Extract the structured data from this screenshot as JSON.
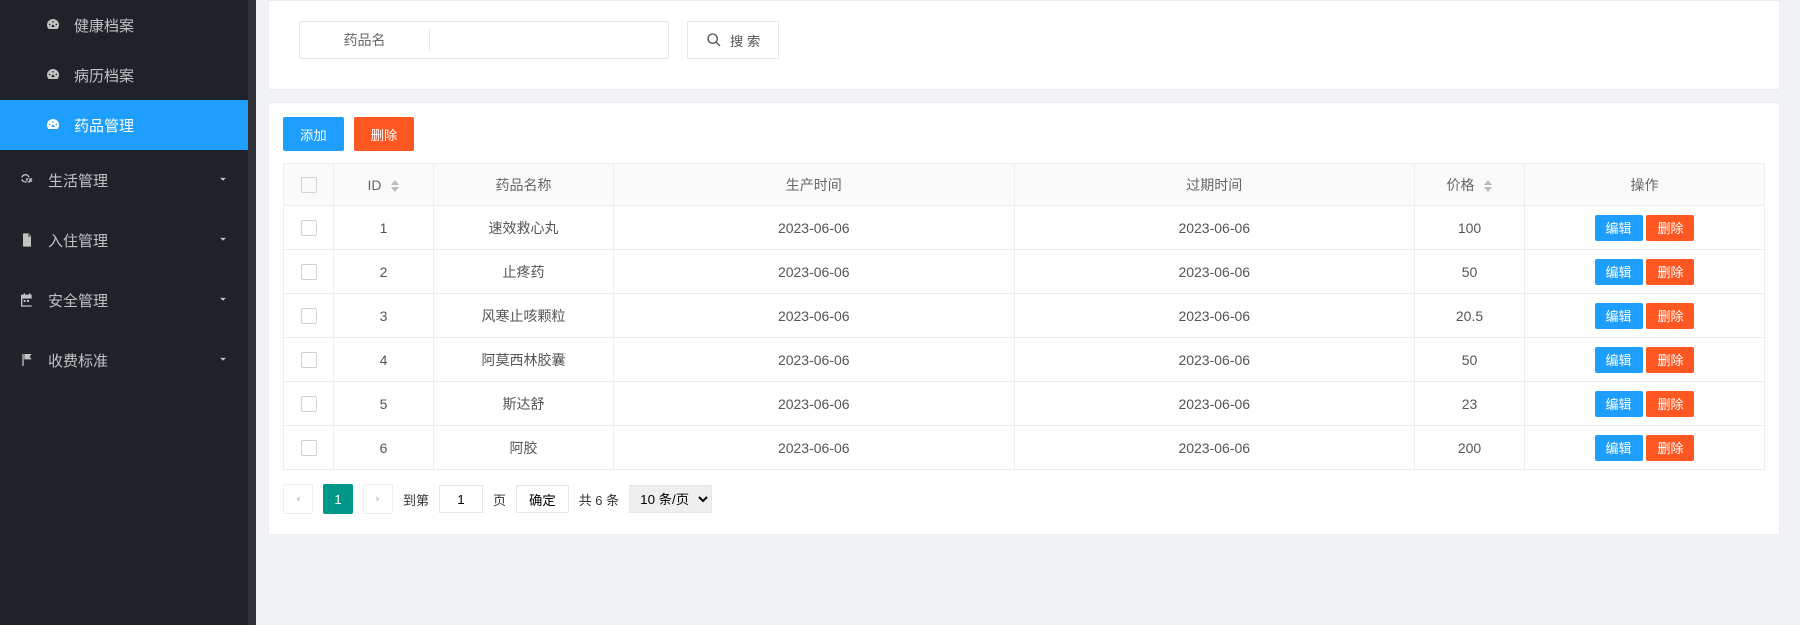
{
  "sidebar": {
    "items": [
      {
        "label": "健康档案",
        "kind": "sub"
      },
      {
        "label": "病历档案",
        "kind": "sub"
      },
      {
        "label": "药品管理",
        "kind": "sub",
        "active": true
      },
      {
        "label": "生活管理",
        "kind": "group"
      },
      {
        "label": "入住管理",
        "kind": "group"
      },
      {
        "label": "安全管理",
        "kind": "group"
      },
      {
        "label": "收费标准",
        "kind": "group"
      }
    ]
  },
  "search": {
    "label": "药品名",
    "value": "",
    "button": "搜 索"
  },
  "toolbar": {
    "add": "添加",
    "del": "删除"
  },
  "table": {
    "headers": {
      "id": "ID",
      "name": "药品名称",
      "produce": "生产时间",
      "expire": "过期时间",
      "price": "价格",
      "ops": "操作"
    },
    "rowActions": {
      "edit": "编辑",
      "delete": "删除"
    },
    "rows": [
      {
        "id": "1",
        "name": "速效救心丸",
        "produce": "2023-06-06",
        "expire": "2023-06-06",
        "price": "100"
      },
      {
        "id": "2",
        "name": "止疼药",
        "produce": "2023-06-06",
        "expire": "2023-06-06",
        "price": "50"
      },
      {
        "id": "3",
        "name": "风寒止咳颗粒",
        "produce": "2023-06-06",
        "expire": "2023-06-06",
        "price": "20.5"
      },
      {
        "id": "4",
        "name": "阿莫西林胶囊",
        "produce": "2023-06-06",
        "expire": "2023-06-06",
        "price": "50"
      },
      {
        "id": "5",
        "name": "斯达舒",
        "produce": "2023-06-06",
        "expire": "2023-06-06",
        "price": "23"
      },
      {
        "id": "6",
        "name": "阿胶",
        "produce": "2023-06-06",
        "expire": "2023-06-06",
        "price": "200"
      }
    ]
  },
  "pager": {
    "current": "1",
    "gotoLabelPrefix": "到第",
    "gotoLabelSuffix": "页",
    "gotoValue": "1",
    "confirm": "确定",
    "total": "共 6 条",
    "perPage": "10 条/页"
  }
}
